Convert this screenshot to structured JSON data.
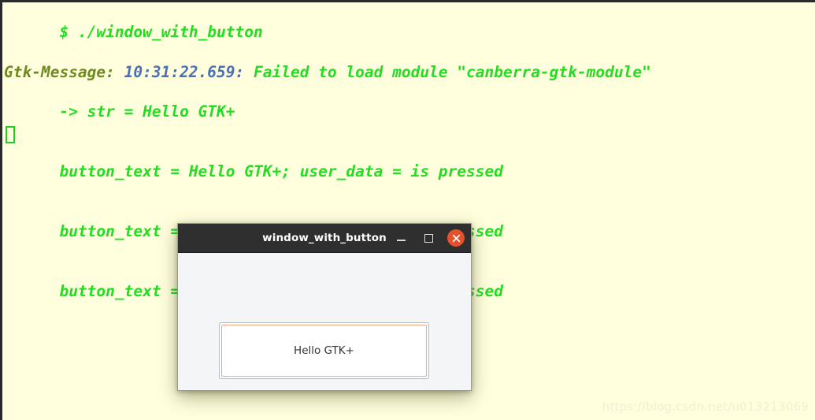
{
  "terminal": {
    "background_color": "#ffffdd",
    "text_color": "#22dd22",
    "lines": [
      {
        "id": "prompt",
        "text": "$ ./window_with_button"
      },
      {
        "id": "gtk_message_prefix",
        "text": "Gtk-Message: "
      },
      {
        "id": "gtk_message_time",
        "text": "10:31:22.659: "
      },
      {
        "id": "gtk_message_body",
        "text": "Failed to load module \"canberra-gtk-module\""
      },
      {
        "id": "str_line",
        "text": "-> str = Hello GTK+"
      },
      {
        "id": "press_1",
        "text": "button_text = Hello GTK+; user_data = is pressed"
      },
      {
        "id": "press_2",
        "text": "button_text = Hello GTK+; user_data = is pressed"
      },
      {
        "id": "press_3",
        "text": "button_text = Hello GTK+; user_data = is pressed"
      }
    ],
    "cursor": "block-cursor"
  },
  "watermark": {
    "text": "https://blog.csdn.net/u013213069"
  },
  "gtk_window": {
    "title": "window_with_button",
    "titlebar_color": "#2f2f2f",
    "body_color": "#f4f5f6",
    "close_button_color": "#e8502a",
    "controls": {
      "minimize_label": "Minimize",
      "maximize_label": "Maximize",
      "close_label": "Close"
    },
    "button": {
      "label": "Hello GTK+",
      "focus_border_color": "#e8a882",
      "text_color": "#2e3436"
    }
  }
}
